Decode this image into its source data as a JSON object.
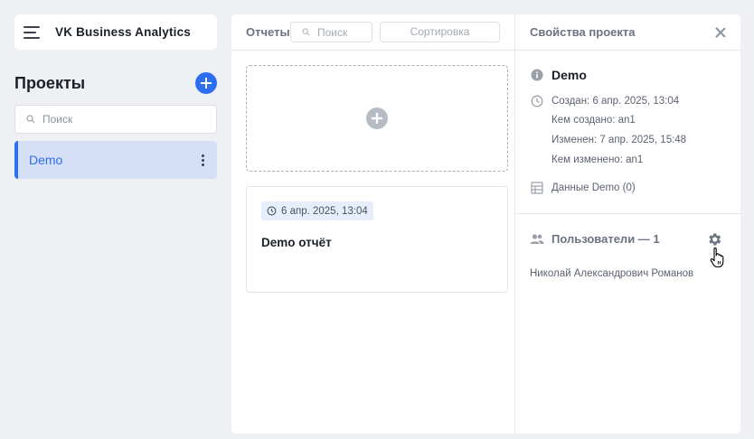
{
  "app": {
    "title": "VK Business Analytics"
  },
  "projects": {
    "heading": "Проекты",
    "search_placeholder": "Поиск",
    "items": [
      {
        "label": "Demo",
        "selected": true
      }
    ]
  },
  "reports": {
    "heading": "Отчеты",
    "search_placeholder": "Поиск",
    "sort_label": "Сортировка",
    "cards": [
      {
        "date": "6 апр. 2025, 13:04",
        "name": "Demo отчёт"
      }
    ]
  },
  "properties": {
    "heading": "Свойства проекта",
    "project_name": "Demo",
    "created": "Создан: 6 апр. 2025, 13:04",
    "created_by": "Кем создано: an1",
    "modified": "Изменен: 7 апр. 2025, 15:48",
    "modified_by": "Кем изменено: an1",
    "data_label": "Данные Demo (0)",
    "users_heading": "Пользователи — 1",
    "users": [
      "Николай Александрович Романов"
    ]
  },
  "colors": {
    "accent": "#2e6ff2",
    "selected_bg": "#d5e0f6",
    "page_bg": "#eef0f4"
  },
  "icons": [
    "menu-icon",
    "plus-icon",
    "search-icon",
    "more-vertical-icon",
    "clock-icon",
    "info-icon",
    "database-icon",
    "users-icon",
    "gear-icon",
    "close-icon",
    "hand-cursor-icon"
  ]
}
